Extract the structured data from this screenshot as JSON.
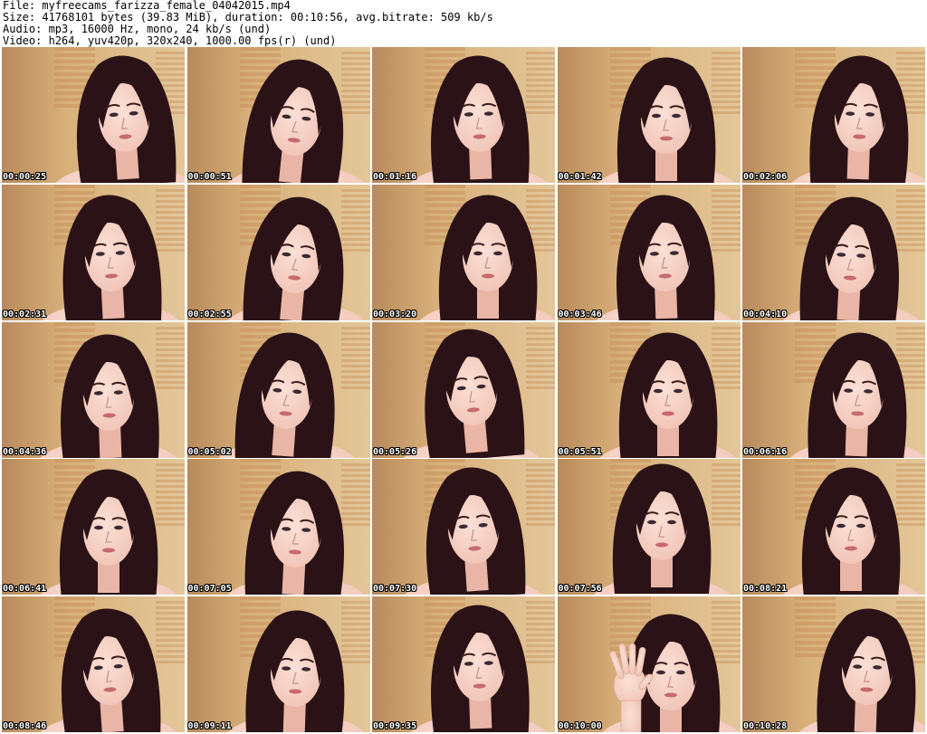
{
  "header": {
    "file_line": "File: myfreecams_farizza_female_04042015.mp4",
    "size_line": "Size: 41768101 bytes (39.83 MiB), duration: 00:10:56, avg.bitrate: 509 kb/s",
    "audio_line": "Audio: mp3, 16000 Hz, mono, 24 kb/s (und)",
    "video_line": "Video: h264, yuv420p, 320x240, 1000.00 fps(r) (und)"
  },
  "colors": {
    "wall": "#d8b07a",
    "blind": "#c9915c",
    "hair": "#2a1216",
    "skin": "#f0c2b4",
    "stamp_text": "#ffffff",
    "stamp_outline": "#000000"
  },
  "thumbnails": [
    {
      "time": "00:00:25"
    },
    {
      "time": "00:00:51"
    },
    {
      "time": "00:01:16"
    },
    {
      "time": "00:01:42"
    },
    {
      "time": "00:02:06"
    },
    {
      "time": "00:02:31"
    },
    {
      "time": "00:02:55"
    },
    {
      "time": "00:03:20"
    },
    {
      "time": "00:03:46"
    },
    {
      "time": "00:04:10"
    },
    {
      "time": "00:04:36"
    },
    {
      "time": "00:05:02"
    },
    {
      "time": "00:05:26"
    },
    {
      "time": "00:05:51"
    },
    {
      "time": "00:06:16"
    },
    {
      "time": "00:06:41"
    },
    {
      "time": "00:07:05"
    },
    {
      "time": "00:07:30"
    },
    {
      "time": "00:07:56"
    },
    {
      "time": "00:08:21"
    },
    {
      "time": "00:08:46"
    },
    {
      "time": "00:09:11"
    },
    {
      "time": "00:09:35"
    },
    {
      "time": "00:10:00"
    },
    {
      "time": "00:10:28"
    }
  ]
}
